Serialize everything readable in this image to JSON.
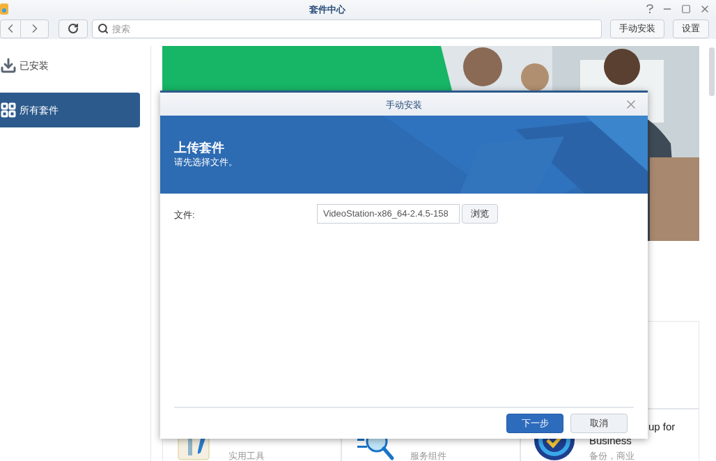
{
  "window": {
    "title": "套件中心"
  },
  "toolbar": {
    "search": {
      "placeholder": "搜索"
    },
    "buttons": [
      "手动安装",
      "设置"
    ]
  },
  "sidebar": {
    "items": [
      {
        "label": "已安装",
        "selected": false,
        "kind": "installed"
      },
      {
        "label": "所有套件",
        "selected": true,
        "kind": "all"
      }
    ]
  },
  "packages": [
    {
      "kind": "tools",
      "category": "实用工具"
    },
    {
      "kind": "service",
      "category": "服务组件"
    },
    {
      "kind": "backup",
      "name_lines": [
        "up for",
        "Business"
      ],
      "category": "备份，商业"
    }
  ],
  "dialog": {
    "title": "手动安装",
    "header": {
      "title": "上传套件",
      "subtitle": "请先选择文件。"
    },
    "file_field": {
      "label": "文件:",
      "value": "VideoStation-x86_64-2.4.5-158",
      "browse": "浏览"
    },
    "buttons": [
      {
        "label": "下一步",
        "kind": "primary"
      },
      {
        "label": "取消",
        "kind": "secondary"
      }
    ]
  }
}
